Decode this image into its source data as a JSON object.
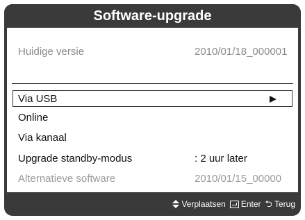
{
  "dialog": {
    "title": "Software-upgrade"
  },
  "version": {
    "label": "Huidige versie",
    "value": "2010/01/18_000001"
  },
  "menu": {
    "items": [
      {
        "label": "Via USB",
        "value": "",
        "selected": true
      },
      {
        "label": "Online",
        "value": ""
      },
      {
        "label": "Via kanaal",
        "value": ""
      },
      {
        "label": "Upgrade standby-modus",
        "value": ": 2 uur later"
      },
      {
        "label": "Alternatieve software",
        "value": "2010/01/15_00000",
        "disabled": true
      }
    ]
  },
  "footer": {
    "move_label": "Verplaatsen",
    "enter_label": "Enter",
    "return_label": "Terug",
    "icons": [
      "updown-arrows-icon",
      "enter-icon",
      "return-icon"
    ]
  }
}
